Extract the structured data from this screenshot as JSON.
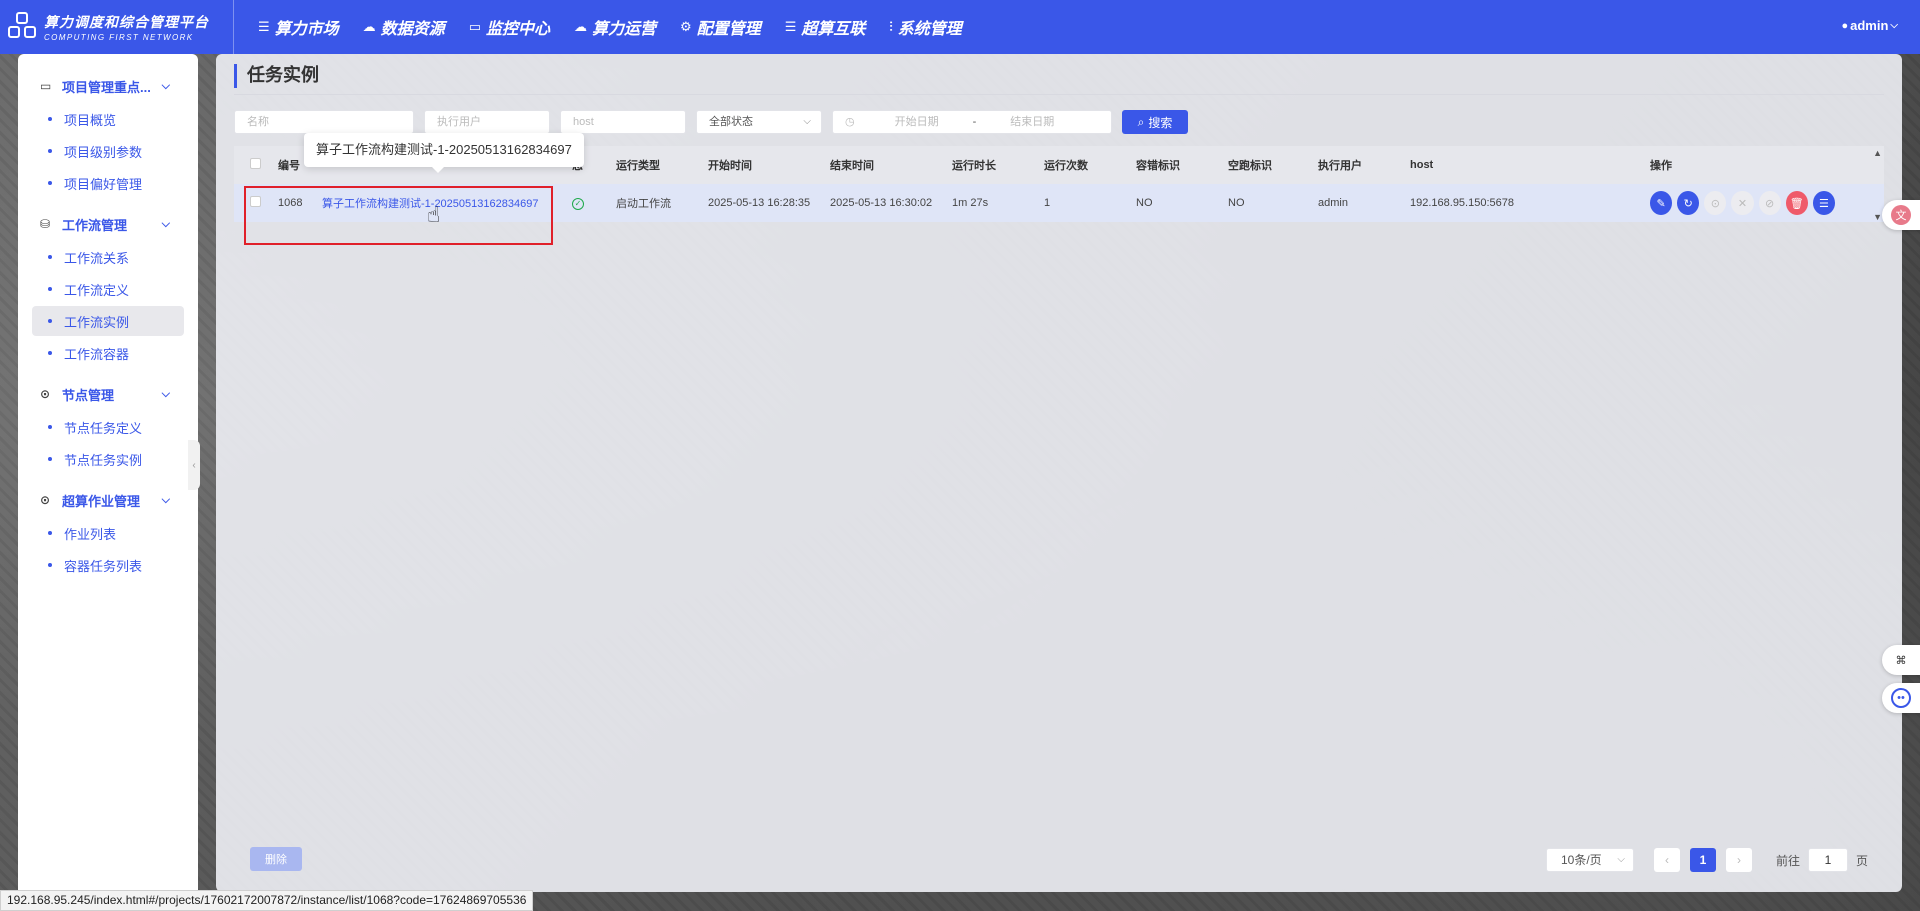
{
  "app": {
    "title": "算力调度和综合管理平台",
    "subtitle": "COMPUTING FIRST NETWORK"
  },
  "nav": {
    "items": [
      {
        "label": "算力市场",
        "icon": "list-icon"
      },
      {
        "label": "数据资源",
        "icon": "cloud-icon"
      },
      {
        "label": "监控中心",
        "icon": "monitor-icon"
      },
      {
        "label": "算力运营",
        "icon": "cloud-icon"
      },
      {
        "label": "配置管理",
        "icon": "gear-icon"
      },
      {
        "label": "超算互联",
        "icon": "list-icon"
      },
      {
        "label": "系统管理",
        "icon": "sliders-icon"
      }
    ],
    "user": "admin"
  },
  "sidebar": {
    "groups": [
      {
        "label": "项目管理重点...",
        "items": [
          "项目概览",
          "项目级别参数",
          "项目偏好管理"
        ]
      },
      {
        "label": "工作流管理",
        "items": [
          "工作流关系",
          "工作流定义",
          "工作流实例",
          "工作流容器"
        ]
      },
      {
        "label": "节点管理",
        "items": [
          "节点任务定义",
          "节点任务实例"
        ]
      },
      {
        "label": "超算作业管理",
        "items": [
          "作业列表",
          "容器任务列表"
        ]
      }
    ],
    "active": "工作流实例"
  },
  "page": {
    "title": "任务实例"
  },
  "filters": {
    "name_placeholder": "名称",
    "user_placeholder": "执行用户",
    "host_placeholder": "host",
    "status_value": "全部状态",
    "start_date_placeholder": "开始日期",
    "date_separator": "-",
    "end_date_placeholder": "结束日期",
    "search_label": "搜索"
  },
  "table": {
    "headers": {
      "id": "编号",
      "status": "态",
      "run_type": "运行类型",
      "start_time": "开始时间",
      "end_time": "结束时间",
      "duration": "运行时长",
      "run_count": "运行次数",
      "fault_tolerant": "容错标识",
      "dry_run": "空跑标识",
      "executor": "执行用户",
      "host": "host",
      "actions": "操作"
    },
    "rows": [
      {
        "id": "1068",
        "name": "算子工作流构建测试-1-20250513162834697",
        "run_type": "启动工作流",
        "start_time": "2025-05-13 16:28:35",
        "end_time": "2025-05-13 16:30:02",
        "duration": "1m 27s",
        "run_count": "1",
        "fault_tolerant": "NO",
        "dry_run": "NO",
        "executor": "admin",
        "host": "192.168.95.150:5678"
      }
    ]
  },
  "tooltip": {
    "text": "算子工作流构建测试-1-20250513162834697"
  },
  "footer": {
    "delete_label": "删除",
    "page_size": "10条/页",
    "current_page": "1",
    "goto_label": "前往",
    "goto_value": "1",
    "page_suffix": "页"
  },
  "status_bar": {
    "url": "192.168.95.245/index.html#/projects/17602172007872/instance/list/1068?code=17624869705536"
  },
  "colors": {
    "primary": "#3a57e8",
    "danger": "#ef5a6a",
    "success": "#1ea94a",
    "highlight_box": "#e0202a"
  }
}
